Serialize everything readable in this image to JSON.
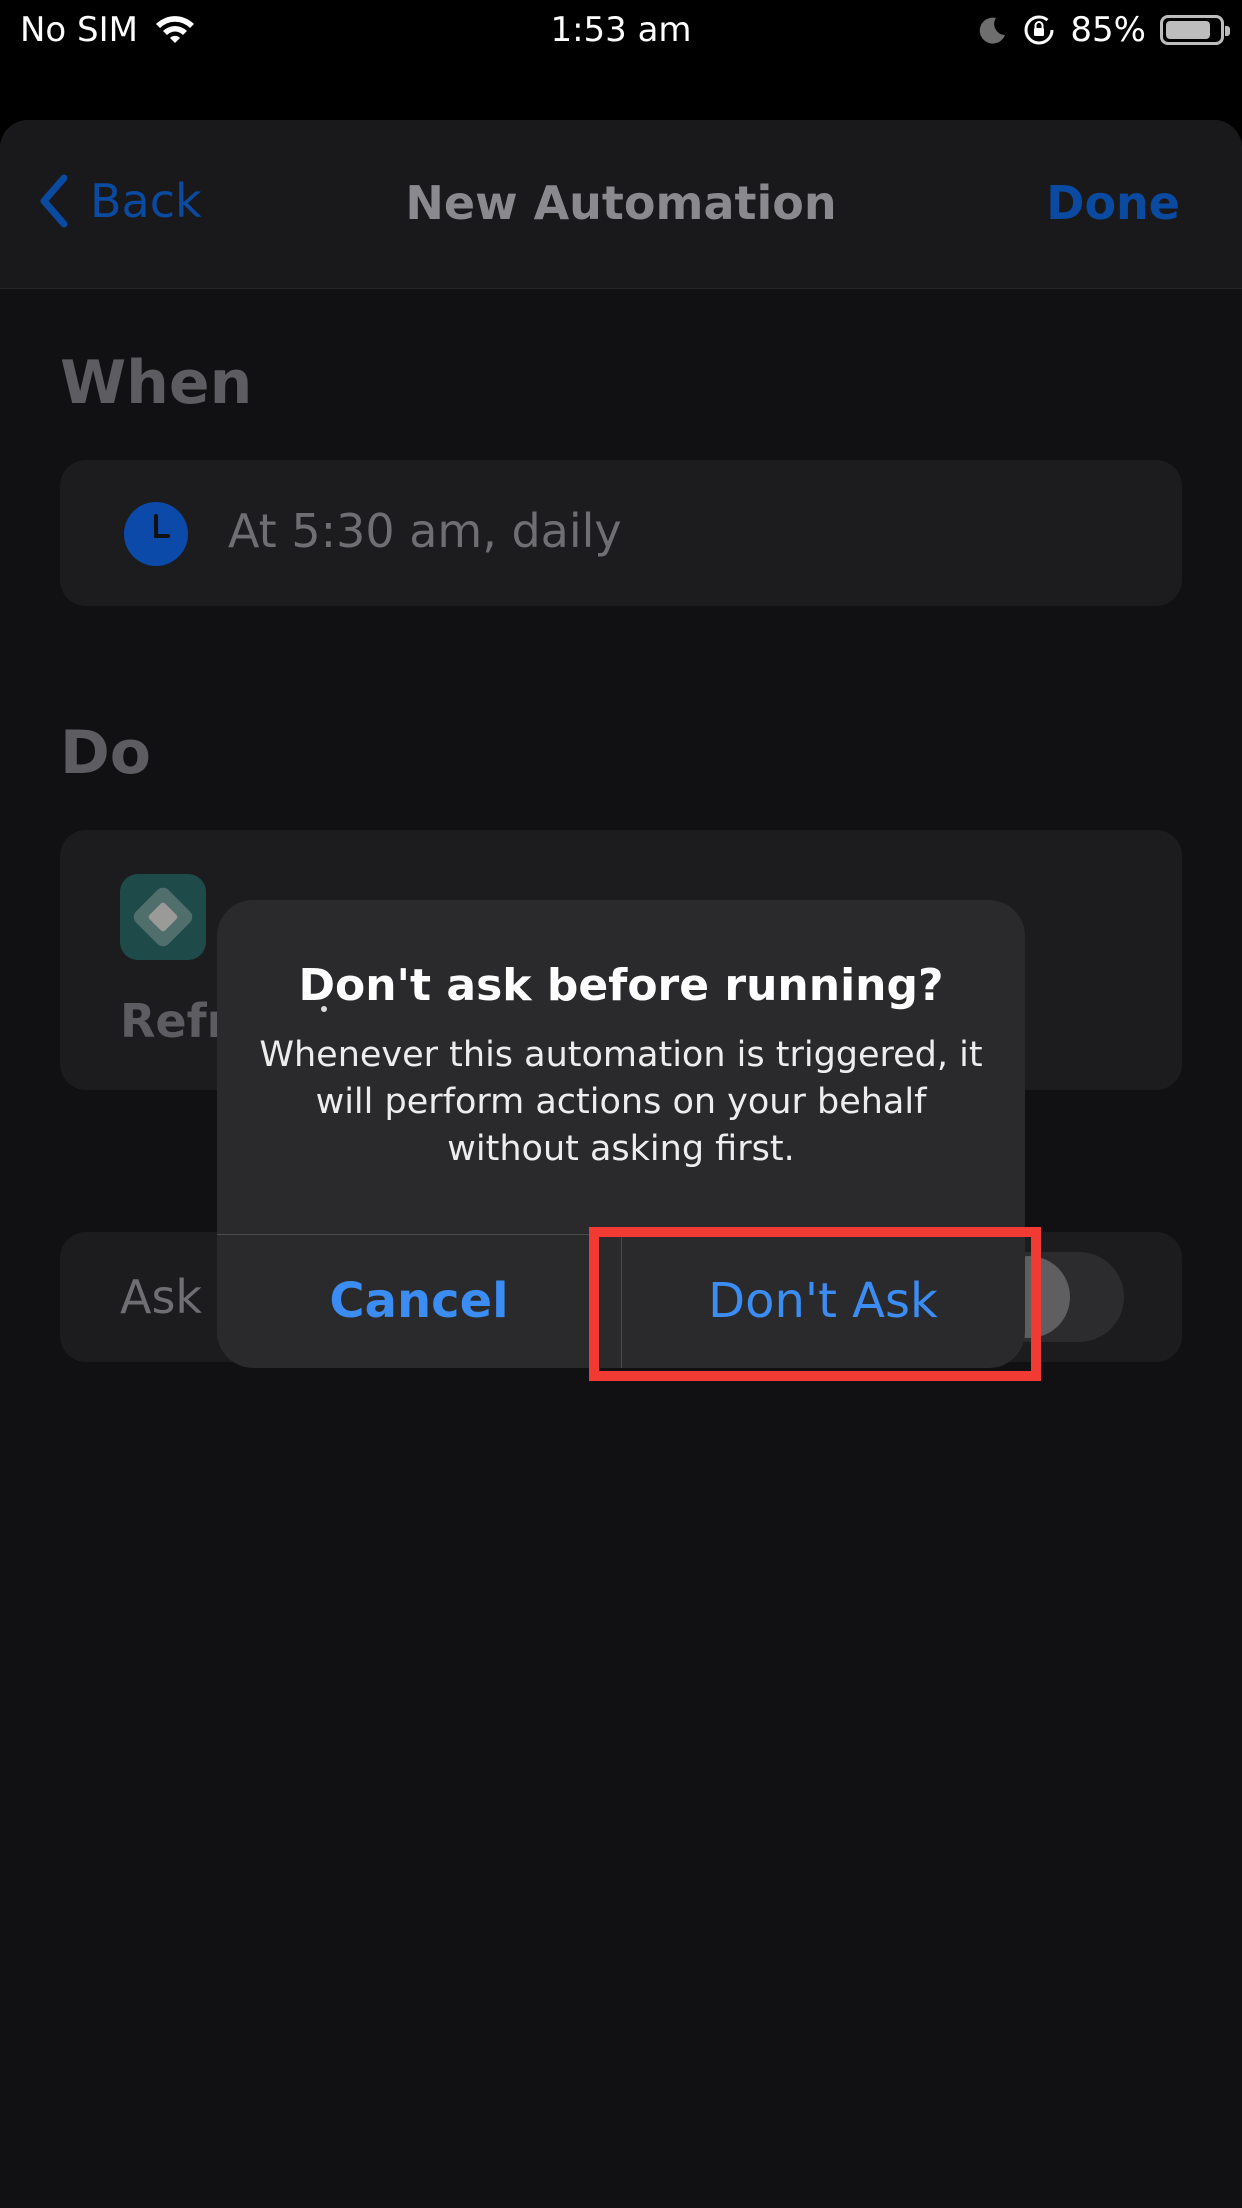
{
  "status_bar": {
    "carrier": "No SIM",
    "time": "1:53 am",
    "battery_percent": "85%",
    "battery_level": 0.85,
    "icons": [
      "wifi-icon",
      "moon-icon",
      "rotation-lock-icon",
      "battery-icon"
    ]
  },
  "nav": {
    "back_label": "Back",
    "title": "New Automation",
    "done_label": "Done"
  },
  "when": {
    "section_title": "When",
    "trigger_text": "At 5:30 am, daily",
    "icon": "clock-icon"
  },
  "do": {
    "section_title": "Do",
    "action_label_partial": "Refr",
    "icon": "app-icon"
  },
  "ask_setting": {
    "label_partial": "Ask E",
    "toggle_on": false
  },
  "alert": {
    "dot": ".",
    "title": "Don't ask before running?",
    "message": "Whenever this automation is triggered, it will perform actions on your behalf without asking first.",
    "cancel_label": "Cancel",
    "confirm_label": "Don't Ask"
  },
  "colors": {
    "accent_blue": "#3b8cf3",
    "dim_blue": "#0a4aa0",
    "highlight_red": "#f23a35",
    "background": "#111113"
  }
}
